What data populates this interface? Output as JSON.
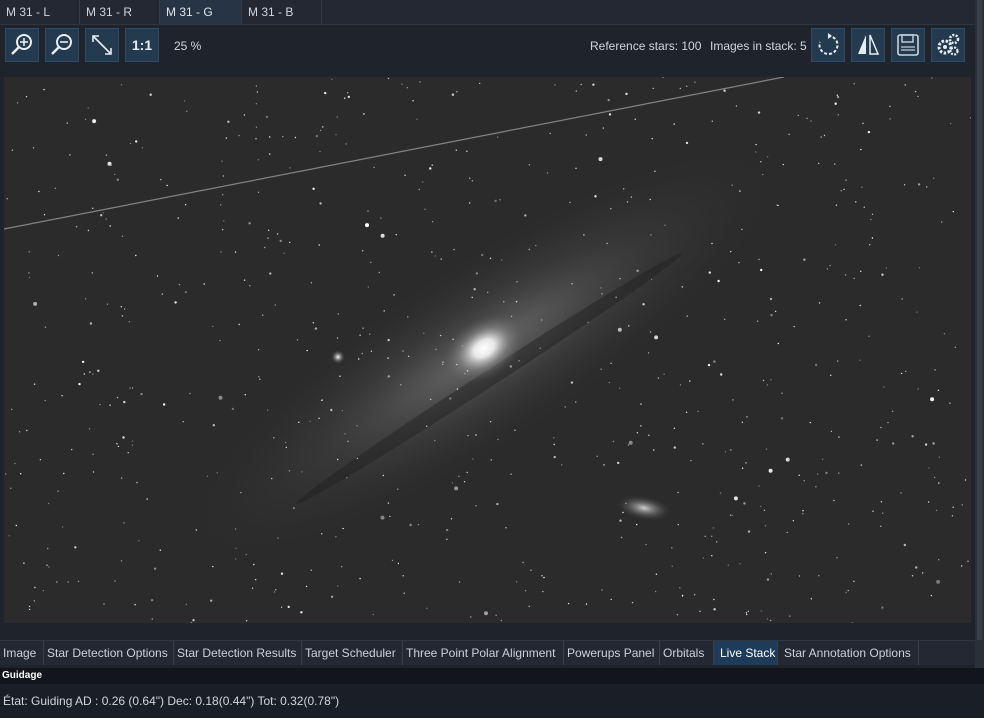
{
  "tabs": [
    {
      "label": "M 31 - L",
      "active": false
    },
    {
      "label": "M 31 - R",
      "active": false
    },
    {
      "label": "M 31 - G",
      "active": true
    },
    {
      "label": "M 31 - B",
      "active": false
    }
  ],
  "toolbar": {
    "one_to_one_label": "1:1",
    "zoom_level": "25 %",
    "reference_stars": "Reference stars: 100",
    "images_in_stack": "Images in stack: 5"
  },
  "icons": {
    "zoom_in": "zoom-in-icon",
    "zoom_out": "zoom-out-icon",
    "fit": "fit-to-screen-icon",
    "rotate": "rotate-icon",
    "flip": "flip-icon",
    "save": "save-icon",
    "settings": "settings-icon"
  },
  "bottom_tabs": [
    {
      "label": "Image",
      "active": false
    },
    {
      "label": "Star Detection Options",
      "active": false
    },
    {
      "label": "Star Detection Results",
      "active": false
    },
    {
      "label": "Target Scheduler",
      "active": false
    },
    {
      "label": "Three Point Polar Alignment",
      "active": false
    },
    {
      "label": "Powerups Panel",
      "active": false
    },
    {
      "label": "Orbitals",
      "active": false
    },
    {
      "label": "Live Stack",
      "active": true
    },
    {
      "label": "Star Annotation Options",
      "active": false
    }
  ],
  "guiding": {
    "header": "Guidage",
    "status": "État: Guiding  AD : 0.26 (0.64\")  Dec: 0.18(0.44\")  Tot: 0.32(0.78\")"
  },
  "colors": {
    "accent_active_tab": "#1f3b5a",
    "button_bg": "#243a4e",
    "background": "#1e232c"
  }
}
